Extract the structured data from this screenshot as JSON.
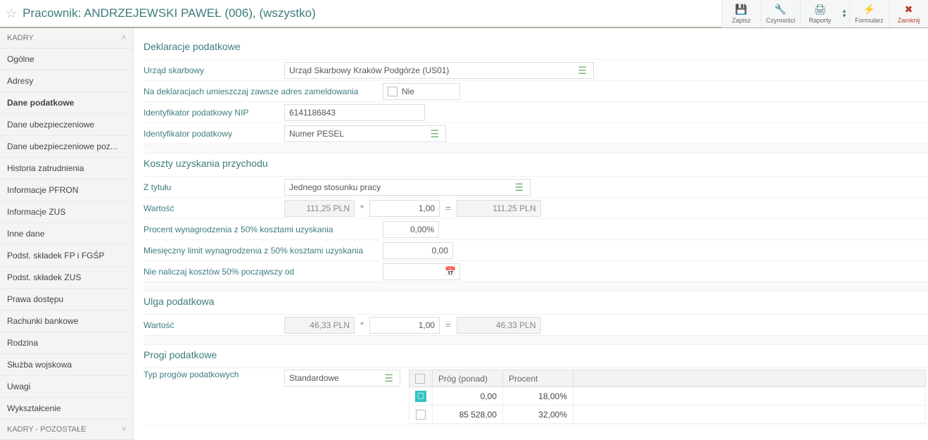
{
  "header": {
    "title": "Pracownik: ANDRZEJEWSKI PAWEŁ (006), (wszystko)"
  },
  "toolbar": {
    "save": "Zapisz",
    "actions": "Czynności",
    "reports": "Raporty",
    "form": "Formularz",
    "close": "Zamknij"
  },
  "sidebar": {
    "cat1": "KADRY",
    "items": [
      "Ogólne",
      "Adresy",
      "Dane podatkowe",
      "Dane ubezpieczeniowe",
      "Dane ubezpieczeniowe poz...",
      "Historia zatrudnienia",
      "Informacje PFRON",
      "Informacje ZUS",
      "Inne dane",
      "Podst. składek FP i FGŚP",
      "Podst. składek ZUS",
      "Prawa dostępu",
      "Rachunki bankowe",
      "Rodzina",
      "Służba wojskowa",
      "Uwagi",
      "Wykształcenie"
    ],
    "cat2": "KADRY - POZOSTAŁE"
  },
  "sections": {
    "decl": {
      "title": "Deklaracje podatkowe",
      "office_label": "Urząd skarbowy",
      "office_value": "Urząd Skarbowy Kraków Podgórze (US01)",
      "addr_label": "Na deklaracjach umieszczaj zawsze adres zameldowania",
      "addr_value": "Nie",
      "nip_label": "Identyfikator podatkowy NIP",
      "nip_value": "6141186843",
      "id_label": "Identyfikator podatkowy",
      "id_value": "Numer PESEL"
    },
    "koszty": {
      "title": "Koszty uzyskania przychodu",
      "tytul_label": "Z tytułu",
      "tytul_value": "Jednego stosunku pracy",
      "wartosc_label": "Wartość",
      "base": "111,25 PLN",
      "mult": "1,00",
      "result": "111,25 PLN",
      "procent_label": "Procent wynagrodzenia z 50% kosztami uzyskania",
      "procent_value": "0,00%",
      "limit_label": "Miesięczny limit wynagrodzenia z 50% kosztami uzyskania",
      "limit_value": "0,00",
      "nienal_label": "Nie naliczaj kosztów 50% począwszy od"
    },
    "ulga": {
      "title": "Ulga podatkowa",
      "wartosc_label": "Wartość",
      "base": "46,33 PLN",
      "mult": "1,00",
      "result": "46,33 PLN"
    },
    "progi": {
      "title": "Progi podatkowe",
      "typ_label": "Typ progów podatkowych",
      "typ_value": "Standardowe",
      "col1": "Próg (ponad)",
      "col2": "Procent",
      "rows": [
        {
          "prog": "0,00",
          "procent": "18,00%"
        },
        {
          "prog": "85 528,00",
          "procent": "32,00%"
        }
      ]
    }
  }
}
